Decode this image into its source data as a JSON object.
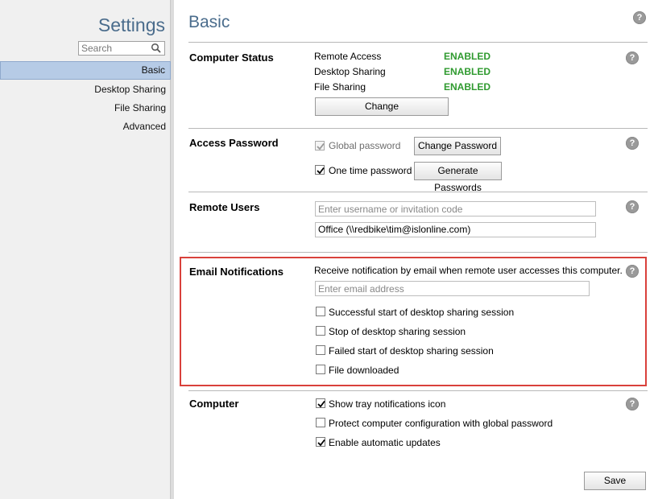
{
  "sidebar": {
    "title": "Settings",
    "search_placeholder": "Search",
    "items": [
      {
        "label": "Basic",
        "active": true
      },
      {
        "label": "Desktop Sharing",
        "active": false
      },
      {
        "label": "File Sharing",
        "active": false
      },
      {
        "label": "Advanced",
        "active": false
      }
    ]
  },
  "page": {
    "title": "Basic"
  },
  "computer_status": {
    "title": "Computer Status",
    "rows": [
      {
        "label": "Remote Access",
        "status": "ENABLED"
      },
      {
        "label": "Desktop Sharing",
        "status": "ENABLED"
      },
      {
        "label": "File Sharing",
        "status": "ENABLED"
      }
    ],
    "change_label": "Change"
  },
  "access_password": {
    "title": "Access Password",
    "global_label": "Global password",
    "global_checked": true,
    "global_disabled": true,
    "change_password_label": "Change Password",
    "one_time_label": "One time password",
    "one_time_checked": true,
    "generate_label": "Generate Passwords"
  },
  "remote_users": {
    "title": "Remote Users",
    "input_placeholder": "Enter username or invitation code",
    "entry": "Office (\\\\redbike\\tim@islonline.com)"
  },
  "email_notifications": {
    "title": "Email Notifications",
    "description": "Receive notification by email when remote user accesses this computer.",
    "email_placeholder": "Enter email address",
    "options": [
      {
        "label": "Successful start of desktop sharing session",
        "checked": false
      },
      {
        "label": "Stop of desktop sharing session",
        "checked": false
      },
      {
        "label": "Failed start of desktop sharing session",
        "checked": false
      },
      {
        "label": "File downloaded",
        "checked": false
      }
    ],
    "highlight_color": "#d9413b"
  },
  "computer": {
    "title": "Computer",
    "options": [
      {
        "label": "Show tray notifications icon",
        "checked": true
      },
      {
        "label": "Protect computer configuration with global password",
        "checked": false
      },
      {
        "label": "Enable automatic updates",
        "checked": true
      }
    ]
  },
  "footer": {
    "save_label": "Save"
  },
  "help_glyph": "?",
  "colors": {
    "accent_title": "#4a6c8c",
    "status_enabled": "#2f9a2f",
    "nav_active": "#b6cbe6"
  }
}
